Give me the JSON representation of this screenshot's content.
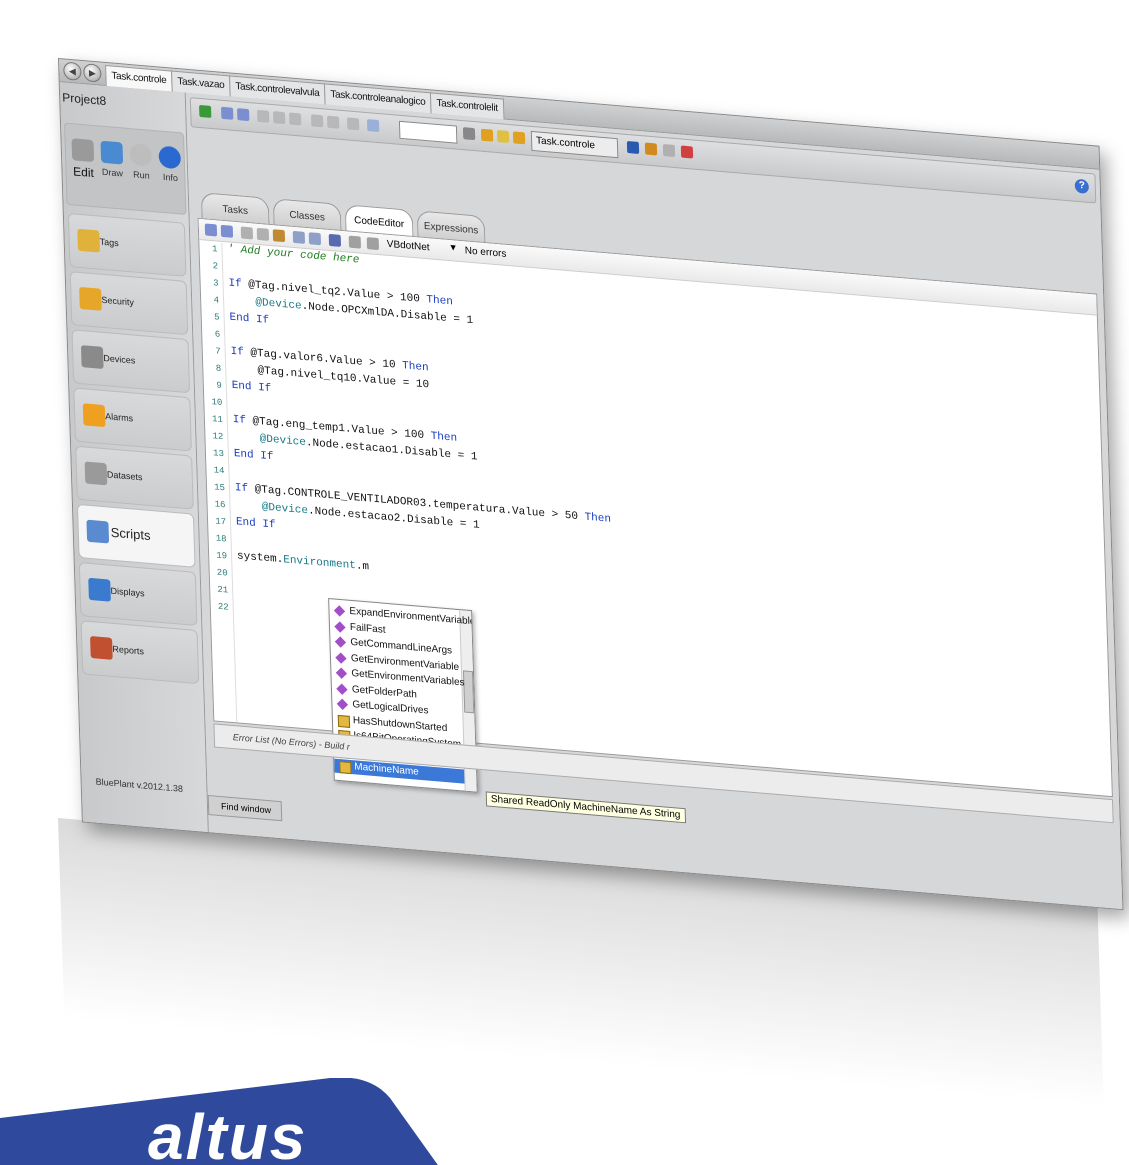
{
  "doc_tabs": [
    "Task.controle",
    "Task.vazao",
    "Task.controlevalvula",
    "Task.controleanalogico",
    "Task.controlelit"
  ],
  "project_name": "Project8",
  "modes": [
    {
      "label": "Edit",
      "icon": "gear-icon"
    },
    {
      "label": "Draw",
      "icon": "monitor-icon"
    },
    {
      "label": "Run",
      "icon": "play-icon"
    },
    {
      "label": "Info",
      "icon": "info-icon"
    }
  ],
  "nav_items": [
    {
      "label": "Tags",
      "icon": "tag-icon",
      "color": "#e0b23c"
    },
    {
      "label": "Security",
      "icon": "lock-icon",
      "color": "#e6a628"
    },
    {
      "label": "Devices",
      "icon": "device-icon",
      "color": "#8a8a8a"
    },
    {
      "label": "Alarms",
      "icon": "warning-icon",
      "color": "#f0a020"
    },
    {
      "label": "Datasets",
      "icon": "database-icon",
      "color": "#9a9a9a"
    },
    {
      "label": "Scripts",
      "icon": "script-icon",
      "color": "#5a8ad0",
      "selected": true
    },
    {
      "label": "Displays",
      "icon": "display-icon",
      "color": "#3a7bd0"
    },
    {
      "label": "Reports",
      "icon": "report-icon",
      "color": "#c05030"
    }
  ],
  "version": "BluePlant v.2012.1.38",
  "toolbar": {
    "task_select": "Task.controle"
  },
  "editor_tabs": [
    "Tasks",
    "Classes",
    "CodeEditor",
    "Expressions"
  ],
  "active_editor_tab": "CodeEditor",
  "editor_bar": {
    "language": "VBdotNet",
    "status": "No errors"
  },
  "code_lines": [
    "' Add your code here",
    "",
    "If @Tag.nivel_tq2.Value > 100 Then",
    "    @Device.Node.OPCXmlDA.Disable = 1",
    "End If",
    "",
    "If @Tag.valor6.Value > 10 Then",
    "    @Tag.nivel_tq10.Value = 10",
    "End If",
    "",
    "If @Tag.eng_temp1.Value > 100 Then",
    "    @Device.Node.estacao1.Disable = 1",
    "End If",
    "",
    "If @Tag.CONTROLE_VENTILADOR03.temperatura.Value > 50 Then",
    "    @Device.Node.estacao2.Disable = 1",
    "End If",
    "",
    "system.Environment.m",
    "",
    "",
    ""
  ],
  "autocomplete": [
    {
      "label": "ExpandEnvironmentVariables",
      "kind": "method"
    },
    {
      "label": "FailFast",
      "kind": "method"
    },
    {
      "label": "GetCommandLineArgs",
      "kind": "method"
    },
    {
      "label": "GetEnvironmentVariable",
      "kind": "method"
    },
    {
      "label": "GetEnvironmentVariables",
      "kind": "method"
    },
    {
      "label": "GetFolderPath",
      "kind": "method"
    },
    {
      "label": "GetLogicalDrives",
      "kind": "method"
    },
    {
      "label": "HasShutdownStarted",
      "kind": "property"
    },
    {
      "label": "Is64BitOperatingSystem",
      "kind": "property"
    },
    {
      "label": "Is64BitProcess",
      "kind": "property"
    },
    {
      "label": "MachineName",
      "kind": "property",
      "selected": true
    }
  ],
  "tooltip": "Shared ReadOnly MachineName As String",
  "error_list": "Error List (No Errors) - Build r",
  "find_window": "Find window",
  "logo_text": "altus",
  "logo_color": "#2f4a9c"
}
